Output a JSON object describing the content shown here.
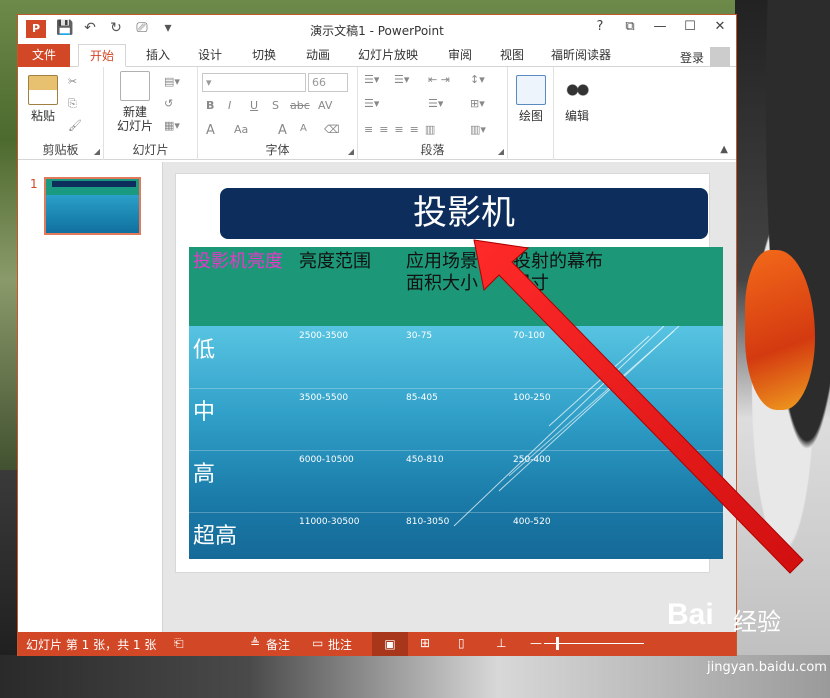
{
  "window": {
    "title": "演示文稿1 - PowerPoint",
    "app_logo": "P",
    "controls": [
      "?",
      "⧉",
      "—",
      "☐",
      "✕"
    ]
  },
  "quick_access": [
    "save-icon",
    "undo-icon",
    "redo-icon",
    "start-from-beginning-icon",
    "customize-qat-icon"
  ],
  "tabs": [
    "文件",
    "开始",
    "插入",
    "设计",
    "切换",
    "动画",
    "幻灯片放映",
    "审阅",
    "视图",
    "福昕阅读器"
  ],
  "active_tab": "开始",
  "login_label": "登录",
  "ribbon": {
    "clipboard": {
      "paste": "粘贴",
      "group": "剪贴板"
    },
    "slides": {
      "new_slide_line1": "新建",
      "new_slide_line2": "幻灯片",
      "group": "幻灯片"
    },
    "font": {
      "size": "66",
      "group": "字体",
      "bold": "B",
      "italic": "I",
      "underline": "U",
      "strike": "S",
      "abc": "abc",
      "spacing": "AV",
      "font_color": "A",
      "change_case": "Aa",
      "grow": "A",
      "shrink": "A"
    },
    "paragraph": {
      "group": "段落"
    },
    "drawing": {
      "label": "绘图"
    },
    "editing": {
      "label": "编辑"
    }
  },
  "thumbnail": {
    "number": "1"
  },
  "slide": {
    "title": "投影机",
    "table": {
      "headers": [
        "投影机亮度",
        "亮度范围",
        "应用场景的面积大小",
        "投射的幕布尺寸"
      ],
      "rows": [
        {
          "label": "低",
          "cells": [
            "2500-3500",
            "30-75",
            "70-100"
          ]
        },
        {
          "label": "中",
          "cells": [
            "3500-5500",
            "85-405",
            "100-250"
          ]
        },
        {
          "label": "高",
          "cells": [
            "6000-10500",
            "450-810",
            "250-400"
          ]
        },
        {
          "label": "超高",
          "cells": [
            "11000-30500",
            "810-3050",
            "400-520"
          ]
        }
      ]
    }
  },
  "status_bar": {
    "slide_info": "幻灯片 第 1 张，共 1 张",
    "notes": "备注",
    "comments": "批注"
  },
  "watermark": {
    "brand": "Bai",
    "product": "经验",
    "url": "jingyan.baidu.com"
  },
  "colors": {
    "accent": "#d24726",
    "title_bg": "#0d2e5c",
    "table_head": "#1c9778",
    "arrow": "#e81a1a"
  }
}
